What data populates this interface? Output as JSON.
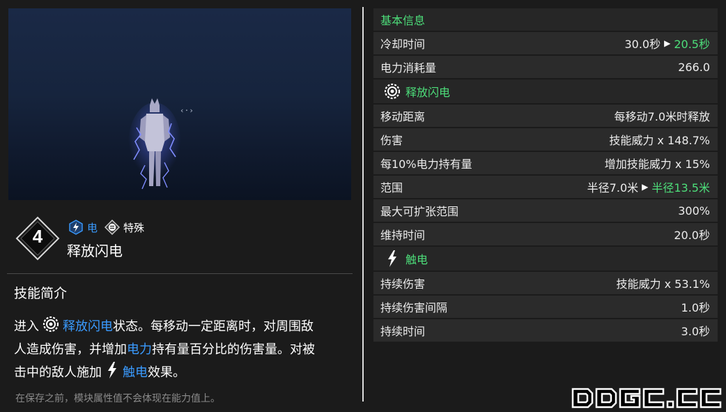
{
  "preview": {
    "cursor_text": "‹·›"
  },
  "skill": {
    "rank": "4",
    "tags": [
      {
        "label": "电",
        "icon": "electric-icon"
      },
      {
        "label": "特殊",
        "icon": "special-icon"
      }
    ],
    "name": "释放闪电"
  },
  "description": {
    "title": "技能简介",
    "line1_prefix": "进入",
    "line1_link": "释放闪电",
    "line1_suffix": "状态。每移动一定距离时，对周围敌",
    "line2_prefix": "人造成伤害，并增加",
    "line2_link": "电力",
    "line2_suffix": "持有量百分比的伤害量。对被",
    "line3_prefix": "击中的敌人施加",
    "line3_link": "触电",
    "line3_suffix": "效果。",
    "note": "在保存之前，模块属性值不会体现在能力值上。"
  },
  "stats": {
    "basic_title": "基本信息",
    "cooldown": {
      "label": "冷却时间",
      "old": "30.0秒",
      "new": "20.5秒"
    },
    "mp_cost": {
      "label": "电力消耗量",
      "value": "266.0"
    },
    "release_title": "释放闪电",
    "move_dist": {
      "label": "移动距离",
      "value": "每移动7.0米时释放"
    },
    "damage": {
      "label": "伤害",
      "value": "技能威力 x 148.7%"
    },
    "per_mp": {
      "label": "每10%电力持有量",
      "value": "增加技能威力 x 15%"
    },
    "range": {
      "label": "范围",
      "old": "半径7.0米",
      "new": "半径13.5米"
    },
    "max_range": {
      "label": "最大可扩张范围",
      "value": "300%"
    },
    "duration": {
      "label": "维持时间",
      "value": "20.0秒"
    },
    "shock_title": "触电",
    "dot_damage": {
      "label": "持续伤害",
      "value": "技能威力 x 53.1%"
    },
    "dot_interval": {
      "label": "持续伤害间隔",
      "value": "1.0秒"
    },
    "dot_duration": {
      "label": "持续时间",
      "value": "3.0秒"
    }
  },
  "watermark": {
    "text": "DDGC.CC"
  },
  "colors": {
    "accent_green": "#4dde7a",
    "accent_blue": "#3a9bff",
    "row_bg": "#2b2b2b",
    "page_bg": "#1b1b1b"
  }
}
